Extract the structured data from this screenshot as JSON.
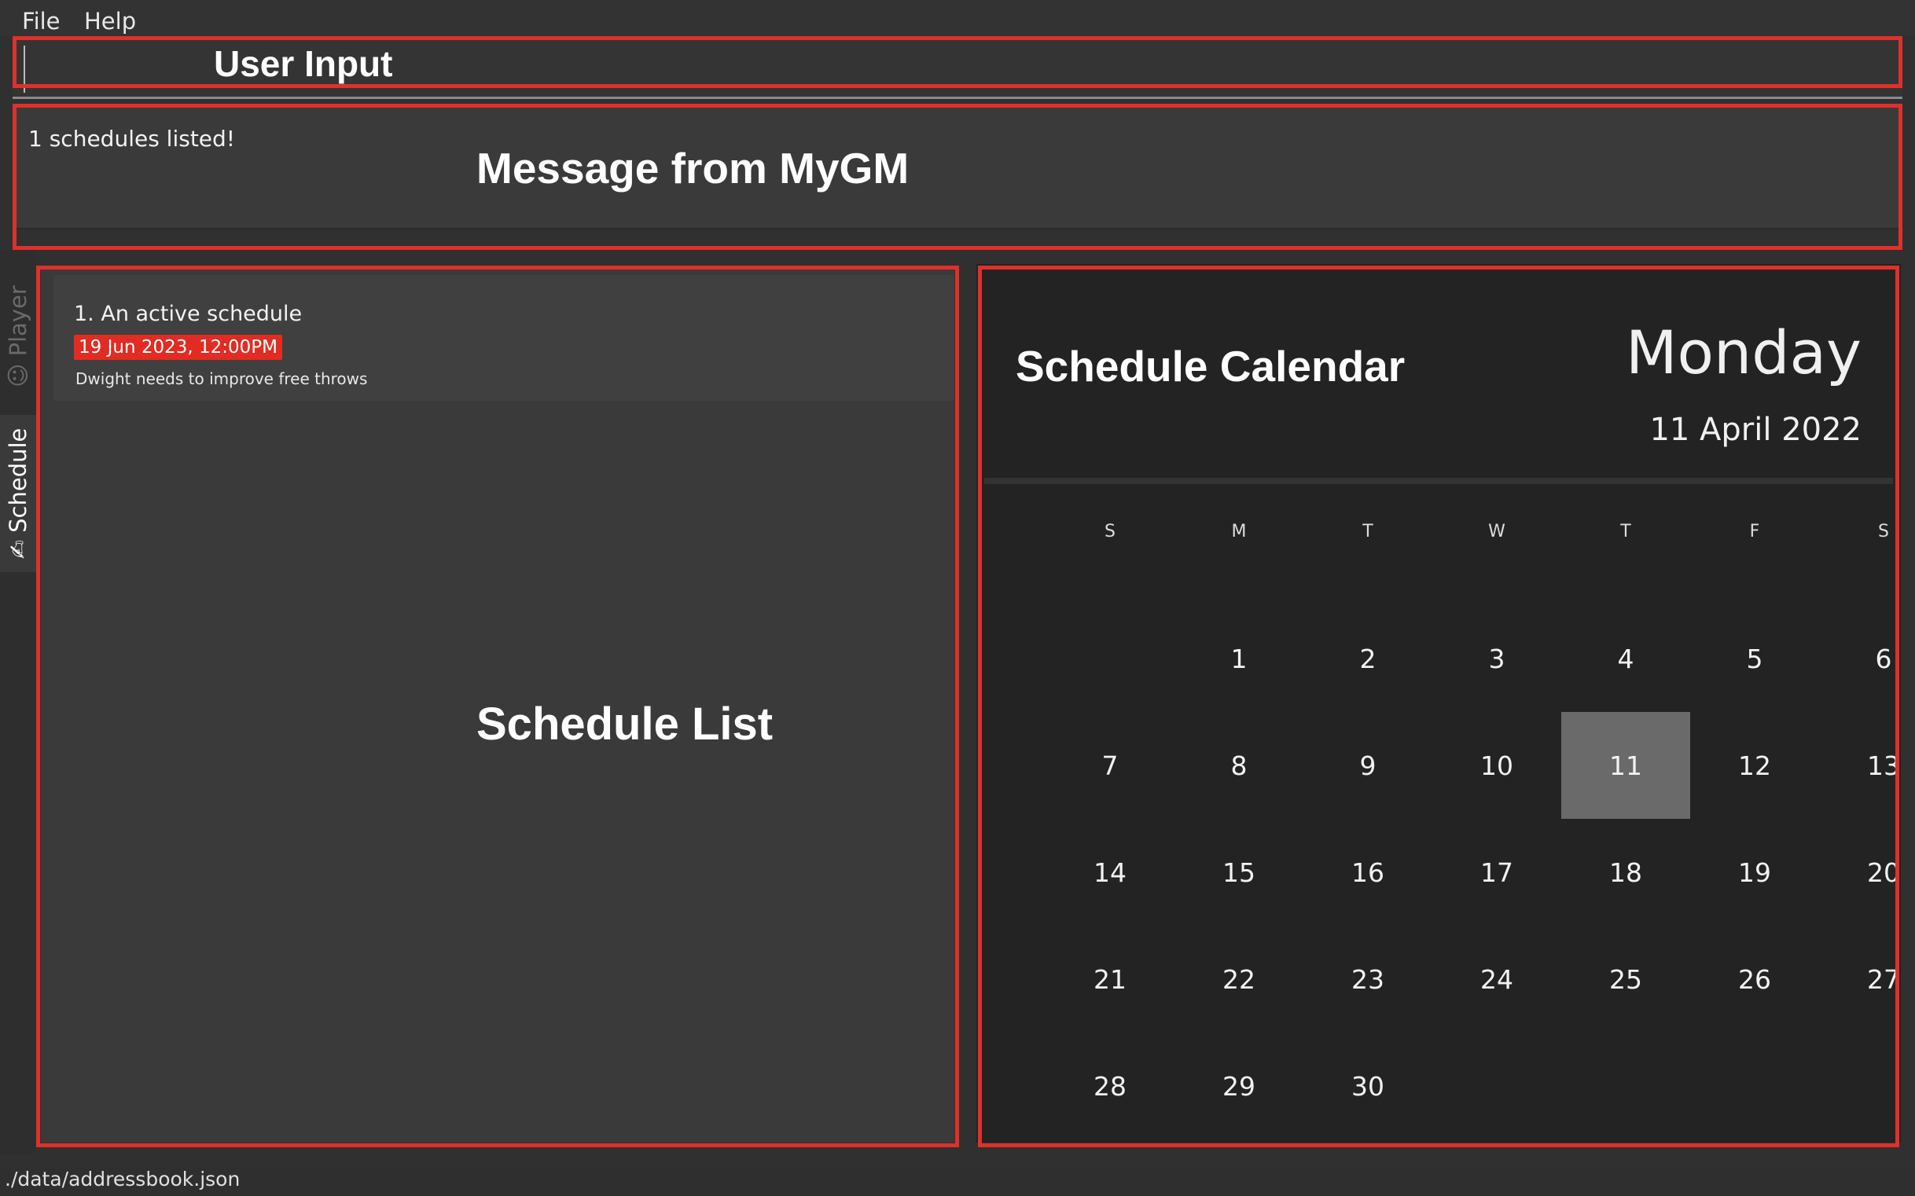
{
  "menu": {
    "file": "File",
    "help": "Help"
  },
  "command": {
    "value": ""
  },
  "result": {
    "message": "1 schedules listed!"
  },
  "tabs": [
    {
      "label": "Player",
      "icon": "person-icon"
    },
    {
      "label": "Schedule",
      "icon": "schedule-icon"
    }
  ],
  "schedules": [
    {
      "title": "1.  An active schedule",
      "date": "19 Jun 2023, 12:00PM",
      "description": "Dwight needs to improve free throws",
      "date_color": "#e22b22"
    }
  ],
  "calendar": {
    "day_name": "Monday",
    "date_text": "11 April 2022",
    "weekdays": [
      "S",
      "M",
      "T",
      "W",
      "T",
      "F",
      "S"
    ],
    "first_weekday_index": 1,
    "days_in_month": 30,
    "selected_day": 11
  },
  "status": {
    "path": "./data/addressbook.json"
  },
  "annotations": {
    "user_input": "User Input",
    "message": "Message from MyGM",
    "schedule_list": "Schedule List",
    "schedule_calendar": "Schedule Calendar",
    "color": "#e0302a"
  }
}
